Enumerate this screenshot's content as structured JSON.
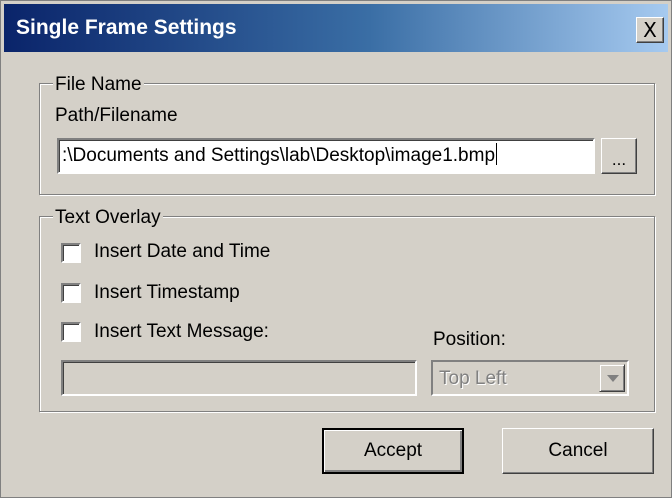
{
  "window": {
    "title": "Single Frame Settings",
    "close_glyph": "X"
  },
  "file_group": {
    "legend": "File Name",
    "path_label": "Path/Filename",
    "path_value": ":\\Documents and Settings\\lab\\Desktop\\image1.bmp",
    "browse_label": "..."
  },
  "overlay_group": {
    "legend": "Text Overlay",
    "options": [
      {
        "label": "Insert Date and Time",
        "checked": false
      },
      {
        "label": "Insert Timestamp",
        "checked": false
      },
      {
        "label": "Insert Text Message:",
        "checked": false
      }
    ],
    "message_value": "",
    "position_label": "Position:",
    "position_value": "Top Left"
  },
  "buttons": {
    "accept": "Accept",
    "cancel": "Cancel"
  },
  "colors": {
    "title_gradient_start": "#0a246a",
    "title_gradient_end": "#a6caf0",
    "face": "#d4d0c8"
  }
}
